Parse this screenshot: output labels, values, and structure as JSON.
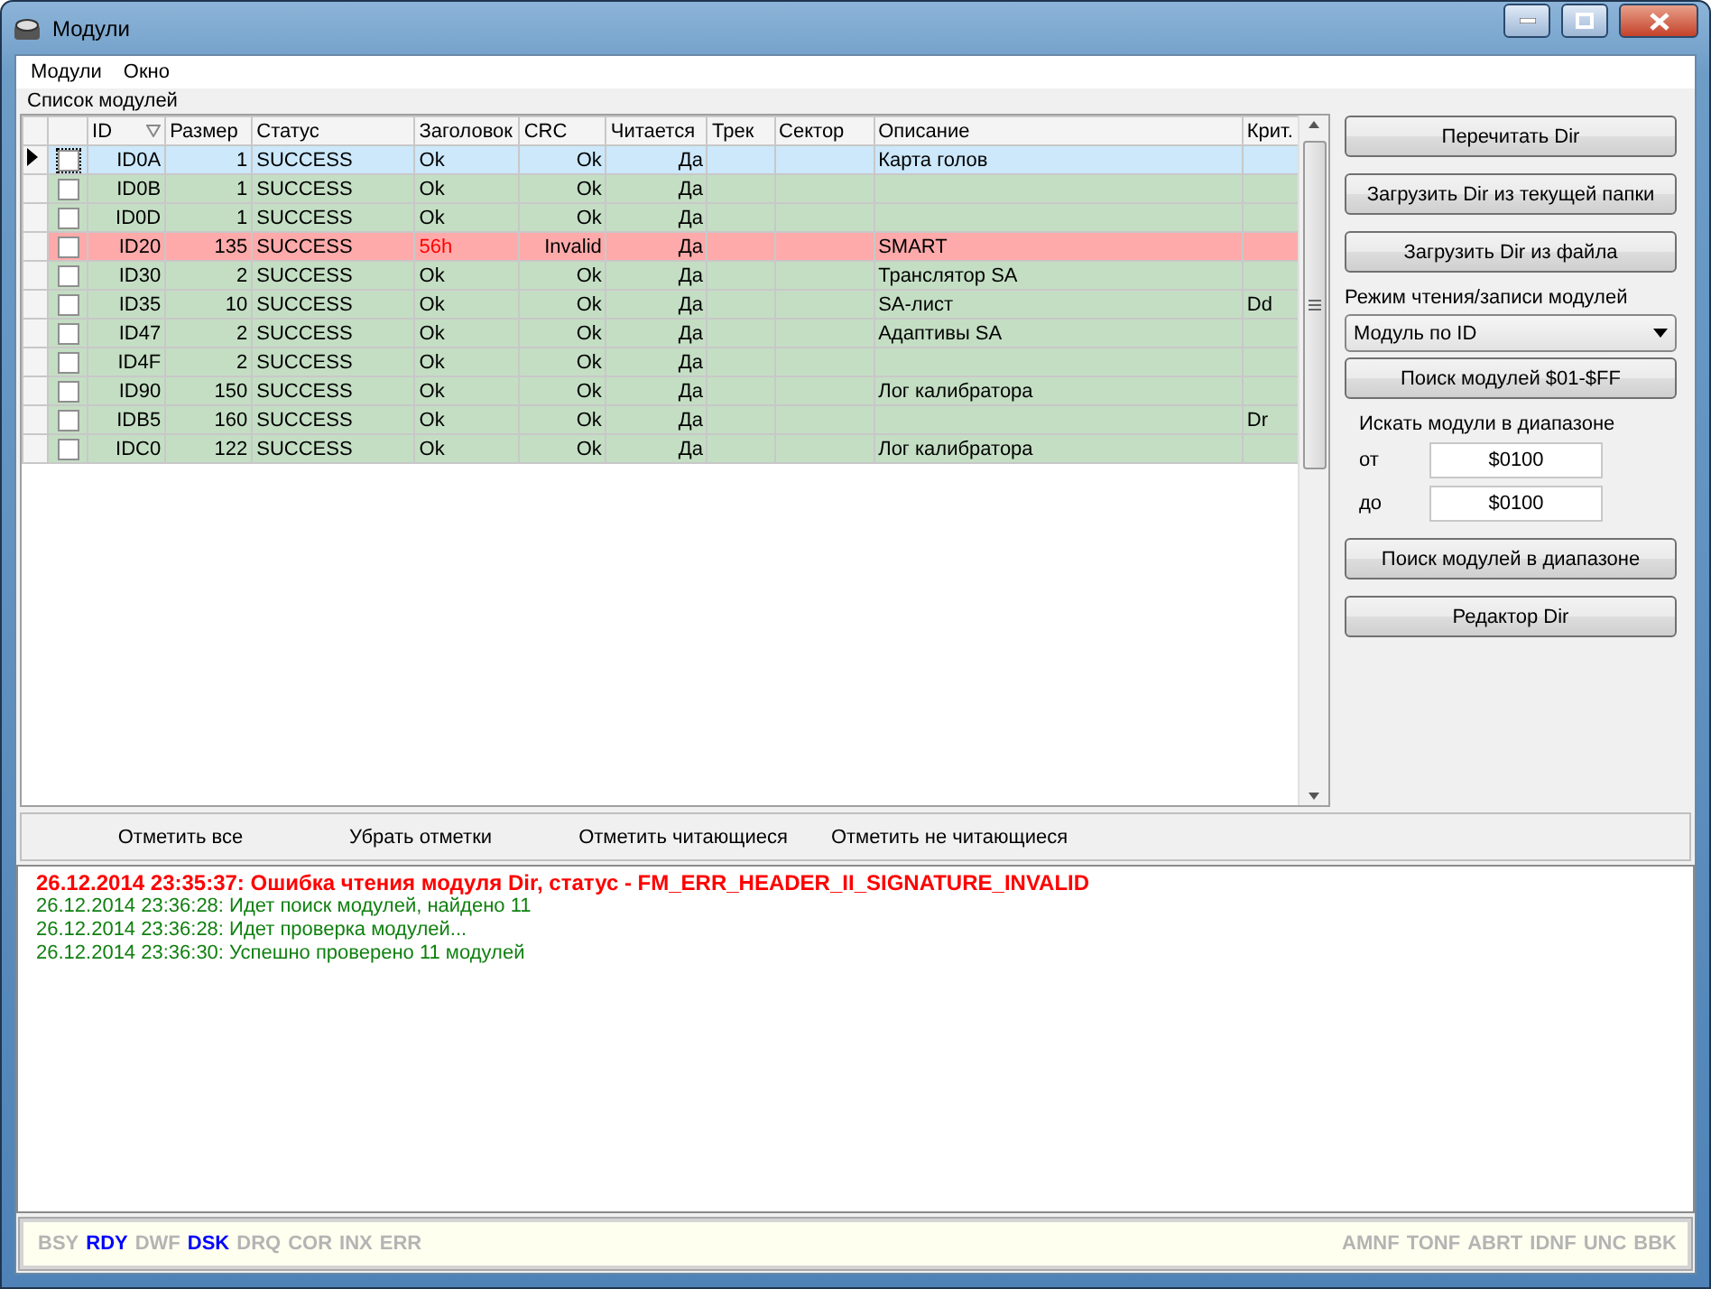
{
  "window": {
    "title": "Модули"
  },
  "menu": [
    "Модули",
    "Окно"
  ],
  "group_label": "Список модулей",
  "table": {
    "columns": [
      "ID",
      "Размер",
      "Статус",
      "Заголовок",
      "CRC",
      "Читается",
      "Трек",
      "Сектор",
      "Описание",
      "Крит."
    ],
    "rows": [
      {
        "selected": true,
        "error": false,
        "checked": false,
        "cells": [
          "ID0A",
          "1",
          "SUCCESS",
          "Ok",
          "Ok",
          "Да",
          "",
          "",
          "Карта голов",
          ""
        ]
      },
      {
        "selected": false,
        "error": false,
        "checked": false,
        "cells": [
          "ID0B",
          "1",
          "SUCCESS",
          "Ok",
          "Ok",
          "Да",
          "",
          "",
          "",
          ""
        ]
      },
      {
        "selected": false,
        "error": false,
        "checked": false,
        "cells": [
          "ID0D",
          "1",
          "SUCCESS",
          "Ok",
          "Ok",
          "Да",
          "",
          "",
          "",
          ""
        ]
      },
      {
        "selected": false,
        "error": true,
        "checked": false,
        "cells": [
          "ID20",
          "135",
          "SUCCESS",
          "56h",
          "Invalid",
          "Да",
          "",
          "",
          "SMART",
          ""
        ]
      },
      {
        "selected": false,
        "error": false,
        "checked": false,
        "cells": [
          "ID30",
          "2",
          "SUCCESS",
          "Ok",
          "Ok",
          "Да",
          "",
          "",
          "Транслятор SA",
          ""
        ]
      },
      {
        "selected": false,
        "error": false,
        "checked": false,
        "cells": [
          "ID35",
          "10",
          "SUCCESS",
          "Ok",
          "Ok",
          "Да",
          "",
          "",
          "SA-лист",
          "Dd"
        ]
      },
      {
        "selected": false,
        "error": false,
        "checked": false,
        "cells": [
          "ID47",
          "2",
          "SUCCESS",
          "Ok",
          "Ok",
          "Да",
          "",
          "",
          "Адаптивы SA",
          ""
        ]
      },
      {
        "selected": false,
        "error": false,
        "checked": false,
        "cells": [
          "ID4F",
          "2",
          "SUCCESS",
          "Ok",
          "Ok",
          "Да",
          "",
          "",
          "",
          ""
        ]
      },
      {
        "selected": false,
        "error": false,
        "checked": false,
        "cells": [
          "ID90",
          "150",
          "SUCCESS",
          "Ok",
          "Ok",
          "Да",
          "",
          "",
          "Лог калибратора",
          ""
        ]
      },
      {
        "selected": false,
        "error": false,
        "checked": false,
        "cells": [
          "IDB5",
          "160",
          "SUCCESS",
          "Ok",
          "Ok",
          "Да",
          "",
          "",
          "",
          "Dr"
        ]
      },
      {
        "selected": false,
        "error": false,
        "checked": false,
        "cells": [
          "IDC0",
          "122",
          "SUCCESS",
          "Ok",
          "Ok",
          "Да",
          "",
          "",
          "Лог калибратора",
          ""
        ]
      }
    ]
  },
  "side": {
    "buttons_top": [
      "Перечитать Dir",
      "Загрузить Dir из текущей папки",
      "Загрузить Dir из файла"
    ],
    "mode_label": "Режим чтения/записи модулей",
    "mode_value": "Модуль по ID",
    "scan_button": "Поиск модулей $01-$FF",
    "range_label": "Искать модули в диапазоне",
    "range": [
      {
        "label": "от",
        "value": "$0100"
      },
      {
        "label": "до",
        "value": "$0100"
      }
    ],
    "buttons_bottom": [
      "Поиск модулей в диапазоне",
      "Редактор Dir"
    ]
  },
  "mark_buttons": [
    "Отметить все",
    "Убрать отметки",
    "Отметить читающиеся",
    "Отметить не читающиеся"
  ],
  "log": [
    {
      "kind": "error",
      "text": "26.12.2014 23:35:37: Ошибка чтения модуля Dir, статус - FM_ERR_HEADER_II_SIGNATURE_INVALID"
    },
    {
      "kind": "info",
      "text": "26.12.2014 23:36:28: Идет поиск модулей, найдено 11"
    },
    {
      "kind": "info",
      "text": "26.12.2014 23:36:28: Идет проверка модулей..."
    },
    {
      "kind": "info",
      "text": "26.12.2014 23:36:30: Успешно проверено 11 модулей"
    }
  ],
  "status_left": [
    {
      "label": "BSY",
      "on": false
    },
    {
      "label": "RDY",
      "on": true
    },
    {
      "label": "DWF",
      "on": false
    },
    {
      "label": "DSK",
      "on": true
    },
    {
      "label": "DRQ",
      "on": false
    },
    {
      "label": "COR",
      "on": false
    },
    {
      "label": "INX",
      "on": false
    },
    {
      "label": "ERR",
      "on": false
    }
  ],
  "status_right": [
    {
      "label": "AMNF",
      "on": false
    },
    {
      "label": "TONF",
      "on": false
    },
    {
      "label": "ABRT",
      "on": false
    },
    {
      "label": "IDNF",
      "on": false
    },
    {
      "label": "UNC",
      "on": false
    },
    {
      "label": "BBK",
      "on": false
    }
  ]
}
